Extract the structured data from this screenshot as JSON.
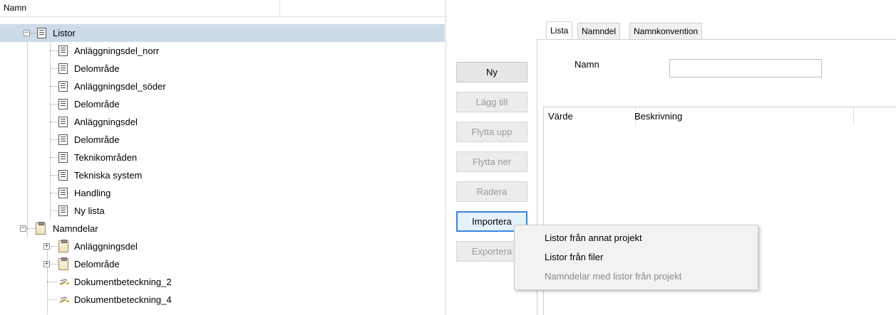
{
  "tree": {
    "column_header": "Namn",
    "rows": [
      {
        "label": "Listor",
        "icon": "list-icon",
        "expander": "minus",
        "selected": true
      },
      {
        "label": "Anläggningsdel_norr",
        "icon": "list-icon"
      },
      {
        "label": "Delområde",
        "icon": "list-icon"
      },
      {
        "label": "Anläggningsdel_söder",
        "icon": "list-icon"
      },
      {
        "label": "Delområde",
        "icon": "list-icon"
      },
      {
        "label": "Anläggningsdel",
        "icon": "list-icon"
      },
      {
        "label": "Delområde",
        "icon": "list-icon"
      },
      {
        "label": "Teknikområden",
        "icon": "list-icon"
      },
      {
        "label": "Tekniska system",
        "icon": "list-icon"
      },
      {
        "label": "Handling",
        "icon": "list-icon"
      },
      {
        "label": "Ny lista",
        "icon": "list-icon"
      },
      {
        "label": "Namndelar",
        "icon": "clipboard-icon",
        "expander": "minus"
      },
      {
        "label": "Anläggningsdel",
        "icon": "clipboard-icon",
        "expander": "plus"
      },
      {
        "label": "Delområde",
        "icon": "clipboard-icon",
        "expander": "plus"
      },
      {
        "label": "Dokumentbeteckning_2",
        "icon": "key-icon"
      },
      {
        "label": "Dokumentbeteckning_4",
        "icon": "key-icon"
      }
    ]
  },
  "buttons": {
    "ny": "Ny",
    "lagg_till": "Lägg till",
    "flytta_upp": "Flytta upp",
    "flytta_ner": "Flytta ner",
    "radera": "Radera",
    "importera": "Importera",
    "exportera": "Exportera"
  },
  "tabs": {
    "lista": "Lista",
    "namndel": "Namndel",
    "namnkonvention": "Namnkonvention"
  },
  "form": {
    "namn_label": "Namn",
    "namn_value": ""
  },
  "grid": {
    "columns": [
      "Värde",
      "Beskrivning"
    ]
  },
  "context_menu": {
    "items": [
      {
        "label": "Listor från annat projekt",
        "enabled": true
      },
      {
        "label": "Listor från filer",
        "enabled": true
      },
      {
        "label": "Namndelar med listor från projekt",
        "enabled": false
      }
    ]
  },
  "colors": {
    "selection": "#cddae8",
    "focus_border": "#3b86d6"
  }
}
